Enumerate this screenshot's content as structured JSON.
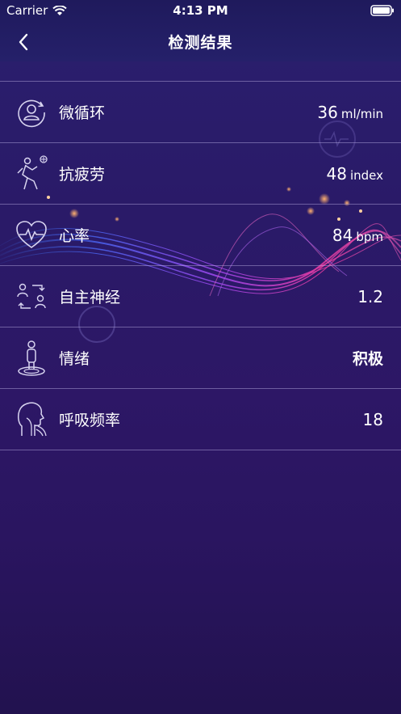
{
  "status_bar": {
    "carrier": "Carrier",
    "time": "4:13 PM"
  },
  "nav": {
    "title": "检测结果"
  },
  "results": [
    {
      "label": "微循环",
      "value": "36",
      "unit": "ml/min",
      "icon": "person-circle-icon"
    },
    {
      "label": "抗疲劳",
      "value": "48",
      "unit": "index",
      "icon": "runner-icon"
    },
    {
      "label": "心率",
      "value": "84",
      "unit": "bpm",
      "icon": "heartbeat-icon"
    },
    {
      "label": "自主神经",
      "value": "1.2",
      "unit": "",
      "icon": "nerve-exchange-icon"
    },
    {
      "label": "情绪",
      "value": "积极",
      "unit": "",
      "icon": "mood-person-icon"
    },
    {
      "label": "呼吸频率",
      "value": "18",
      "unit": "",
      "icon": "breathing-head-icon"
    }
  ]
}
